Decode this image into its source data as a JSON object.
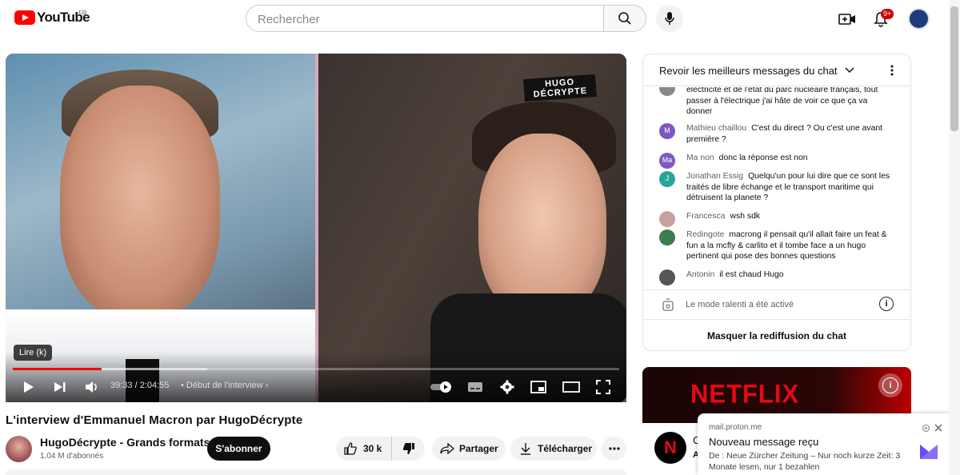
{
  "header": {
    "logo_text": "YouTube",
    "region": "FR",
    "search_placeholder": "Rechercher",
    "notification_badge": "9+"
  },
  "player": {
    "tooltip": "Lire (k)",
    "overlay_logo": "HUGO DÉCRYPTE",
    "time": "39:33 / 2:04:55",
    "chapter": "• Début de l'interview ›",
    "progress_fraction": 0.146,
    "buffer_fraction": 0.32
  },
  "video": {
    "title": "L'interview d'Emmanuel Macron par HugoDécrypte",
    "channel_name": "HugoDécrypte - Grands formats",
    "subscribers": "1,04 M d'abonnés",
    "subscribe_label": "S'abonner",
    "likes": "30 k",
    "share_label": "Partager",
    "download_label": "Télécharger"
  },
  "chat": {
    "header_title": "Revoir les meilleurs messages du chat",
    "messages": [
      {
        "author": "",
        "text": "électricité et de l'état du parc nucléaire français, tout passer à l'électrique j'ai hâte de voir ce que ça va donner",
        "initial": "",
        "color": "#888888"
      },
      {
        "author": "Mathieu chaillou",
        "text": "C'est du direct ? Ou c'est une avant première ?",
        "initial": "M",
        "color": "#7e57c2"
      },
      {
        "author": "Ma non",
        "text": "donc la réponse est non",
        "initial": "Ma",
        "color": "#7e57c2"
      },
      {
        "author": "Jonathan Essig",
        "text": "Quelqu'un pour lui dire que ce sont les traités de libre échange et le transport maritime qui détruisent la planete ?",
        "initial": "J",
        "color": "#26a69a"
      },
      {
        "author": "Francesca",
        "text": "wsh sdk",
        "initial": "",
        "color": "#c9a0a0"
      },
      {
        "author": "Redingote",
        "text": "macrong il pensait qu'il allait faire un feat & fun a la mcfly & carlito et il tombe face a un hugo pertinent qui pose des bonnes questions",
        "initial": "",
        "color": "#3e7d4e"
      },
      {
        "author": "Antonin",
        "text": "il est chaud Hugo",
        "initial": "",
        "color": "#555555"
      }
    ],
    "slow_mode": "Le mode ralenti a été activé",
    "hide_label": "Masquer la rediffusion du chat"
  },
  "ad": {
    "brand": "NETFLIX",
    "channel_initial": "N",
    "peek_line1": "C",
    "peek_line2": "A"
  },
  "toast": {
    "source": "mail.proton.me",
    "title": "Nouveau message reçu",
    "body": "De : Neue Zürcher Zeitung – Nur noch kurze Zeit: 3 Monate lesen, nur 1 bezahlen"
  },
  "colors": {
    "brand_red": "#ff0000",
    "progress_red": "#ff0000",
    "netflix_red": "#e50914"
  }
}
